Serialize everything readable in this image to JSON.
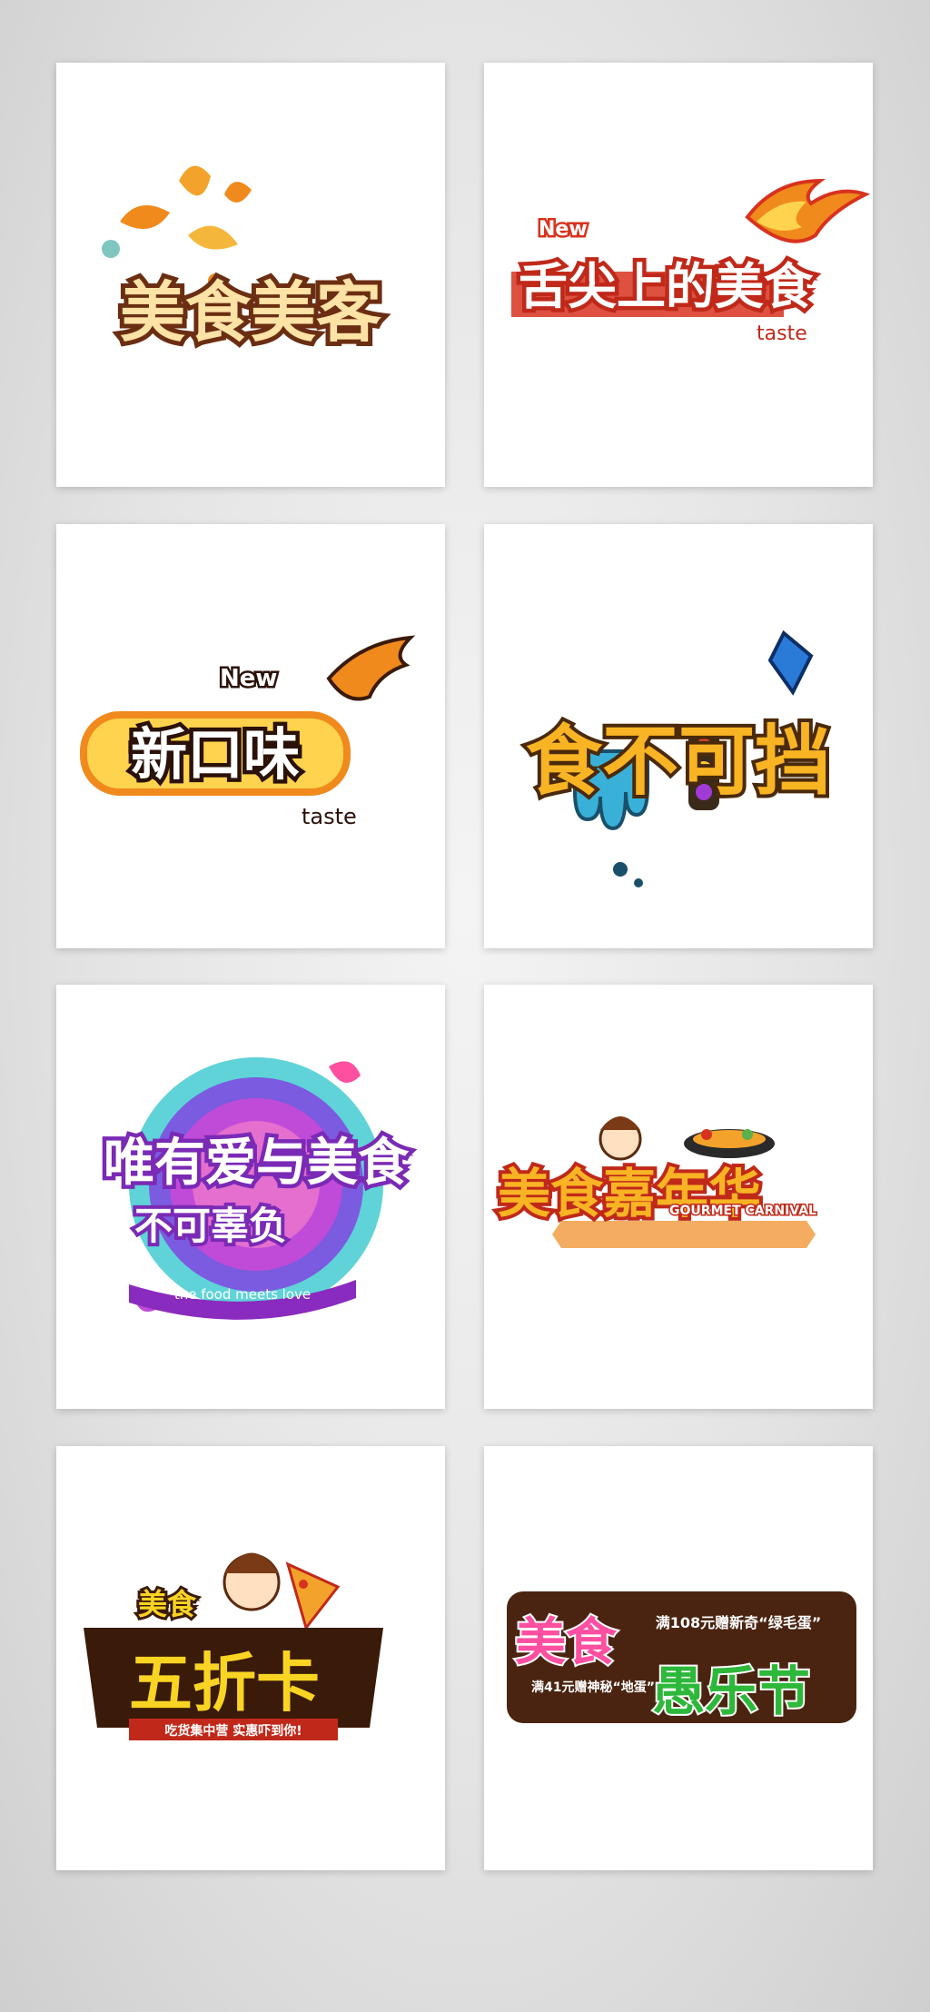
{
  "cards": [
    {
      "title": "美食美客"
    },
    {
      "title": "舌尖上的美食",
      "badge": "New",
      "sub": "taste"
    },
    {
      "title": "新口味",
      "badge": "New",
      "sub": "taste"
    },
    {
      "title": "食不可挡"
    },
    {
      "title": "唯有爱与美食",
      "line2": "不可辜负",
      "sub": "the food meets love"
    },
    {
      "title": "美食嘉年华",
      "sub": "GOURMET CARNIVAL"
    },
    {
      "top": "美食",
      "title": "五折卡",
      "sub": "吃货集中营 实惠吓到你!"
    },
    {
      "title": "美食",
      "title2": "愚乐节",
      "line1": "满108元赠新奇“绿毛蛋”",
      "line2": "满41元赠神秘“地蛋”"
    }
  ],
  "colors": {
    "orange": "#f08a1c",
    "cream": "#ffe3a6",
    "brown": "#5a2a10",
    "red": "#d8321e",
    "purple": "#a13bd6",
    "pink": "#ff4fa0",
    "green": "#2db83a"
  }
}
